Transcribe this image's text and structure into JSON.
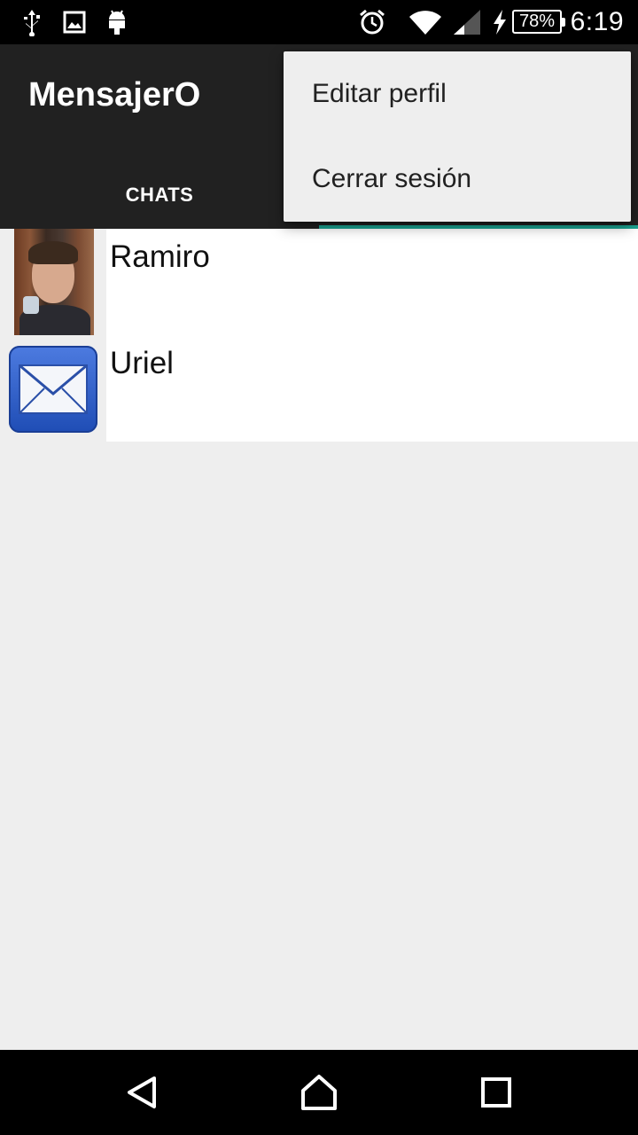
{
  "status_bar": {
    "time": "6:19",
    "battery": "78%",
    "icons": [
      "usb-icon",
      "image-icon",
      "android-icon",
      "alarm-icon",
      "wifi-icon",
      "signal-icon",
      "charging-icon",
      "battery-icon"
    ]
  },
  "app_bar": {
    "title": "MensajerO",
    "tabs": [
      {
        "label": "CHATS"
      }
    ],
    "accent_color": "#1aa391",
    "background_color": "#212121"
  },
  "chats": [
    {
      "name": "Ramiro",
      "avatar": "photo"
    },
    {
      "name": "Uriel",
      "avatar": "mail-icon"
    }
  ],
  "menu": {
    "items": [
      {
        "label": "Editar perfil"
      },
      {
        "label": "Cerrar sesión"
      }
    ]
  },
  "nav_bar": {
    "icons": [
      "back-icon",
      "home-icon",
      "recents-icon"
    ]
  }
}
